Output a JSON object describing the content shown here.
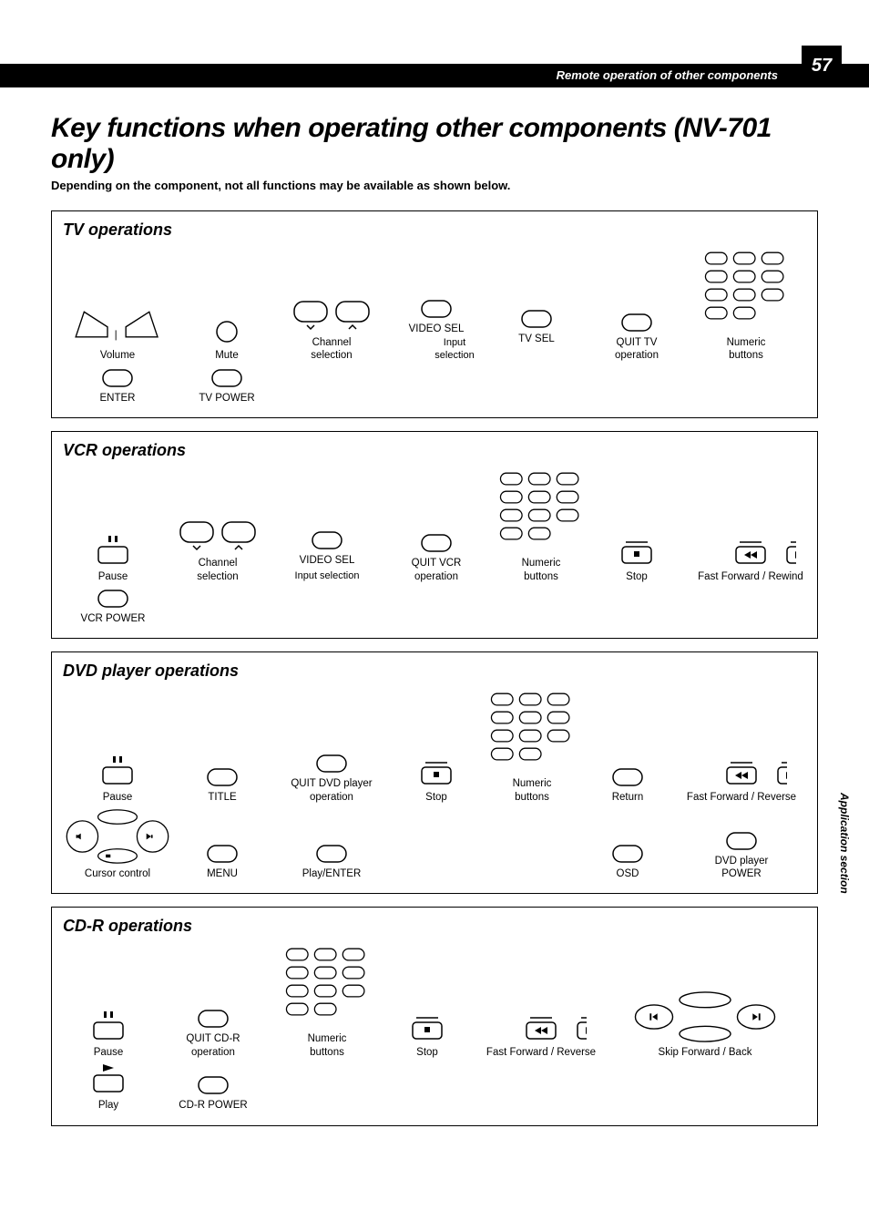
{
  "page_number": "57",
  "banner_text": "Remote operation of other components",
  "title": "Key functions when operating other components (NV-701 only)",
  "subtitle": "Depending on the component, not all functions may be available as shown below.",
  "side_label": "Application section",
  "tv": {
    "title": "TV operations",
    "r1": {
      "volume": "Volume",
      "mute": "Mute",
      "channel": "Channel\nselection",
      "video_sel": "VIDEO SEL",
      "tv_sel": "TV SEL",
      "input_selection": "Input selection",
      "quit": "QUIT TV\noperation",
      "numeric": "Numeric\nbuttons"
    },
    "r2": {
      "enter": "ENTER",
      "tv_power": "TV POWER"
    }
  },
  "vcr": {
    "title": "VCR operations",
    "r1": {
      "pause": "Pause",
      "channel": "Channel\nselection",
      "video_sel": "VIDEO SEL",
      "input_selection": "Input selection",
      "quit": "QUIT VCR\noperation",
      "numeric": "Numeric\nbuttons",
      "stop": "Stop",
      "ffrw": "Fast Forward / Rewind"
    },
    "r2": {
      "vcr_power": "VCR POWER"
    }
  },
  "dvd": {
    "title": "DVD player operations",
    "r1": {
      "pause": "Pause",
      "title_btn": "TITLE",
      "quit": "QUIT DVD player\noperation",
      "stop": "Stop",
      "numeric": "Numeric\nbuttons",
      "return_btn": "Return",
      "ffrv": "Fast Forward / Reverse"
    },
    "r2": {
      "cursor": "Cursor control",
      "menu": "MENU",
      "play_enter": "Play/ENTER",
      "osd": "OSD",
      "dvd_power": "DVD player\nPOWER"
    }
  },
  "cdr": {
    "title": "CD-R operations",
    "r1": {
      "pause": "Pause",
      "quit": "QUIT CD-R\noperation",
      "numeric": "Numeric\nbuttons",
      "stop": "Stop",
      "ffrv": "Fast Forward / Reverse",
      "skip": "Skip Forward / Back"
    },
    "r2": {
      "play": "Play",
      "cdr_power": "CD-R POWER"
    }
  }
}
